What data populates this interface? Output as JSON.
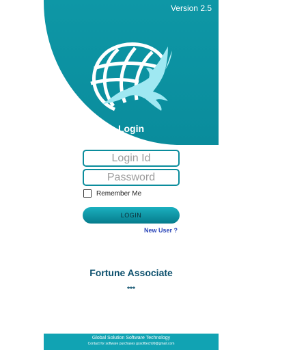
{
  "header": {
    "version": "Version 2.5",
    "title": "Login"
  },
  "form": {
    "login_id_placeholder": "Login Id",
    "password_placeholder": "Password",
    "remember_label": "Remember Me",
    "login_button_label": "LOGIN",
    "new_user_link": "New User ?"
  },
  "company": {
    "name": "Fortune Associate",
    "stars": "***"
  },
  "footer": {
    "company": "Global Solution Software Technology",
    "contact": "Contact for software purchases gssofttech99@gmail.com"
  },
  "colors": {
    "header_teal": "#0a8c9c",
    "footer_teal": "#11a3b3",
    "company_text": "#0b4f6c",
    "link_blue": "#2a45b8"
  },
  "icons": {
    "logo": "globe-eagle-logo-icon",
    "checkbox": "checkbox-unchecked-icon"
  }
}
